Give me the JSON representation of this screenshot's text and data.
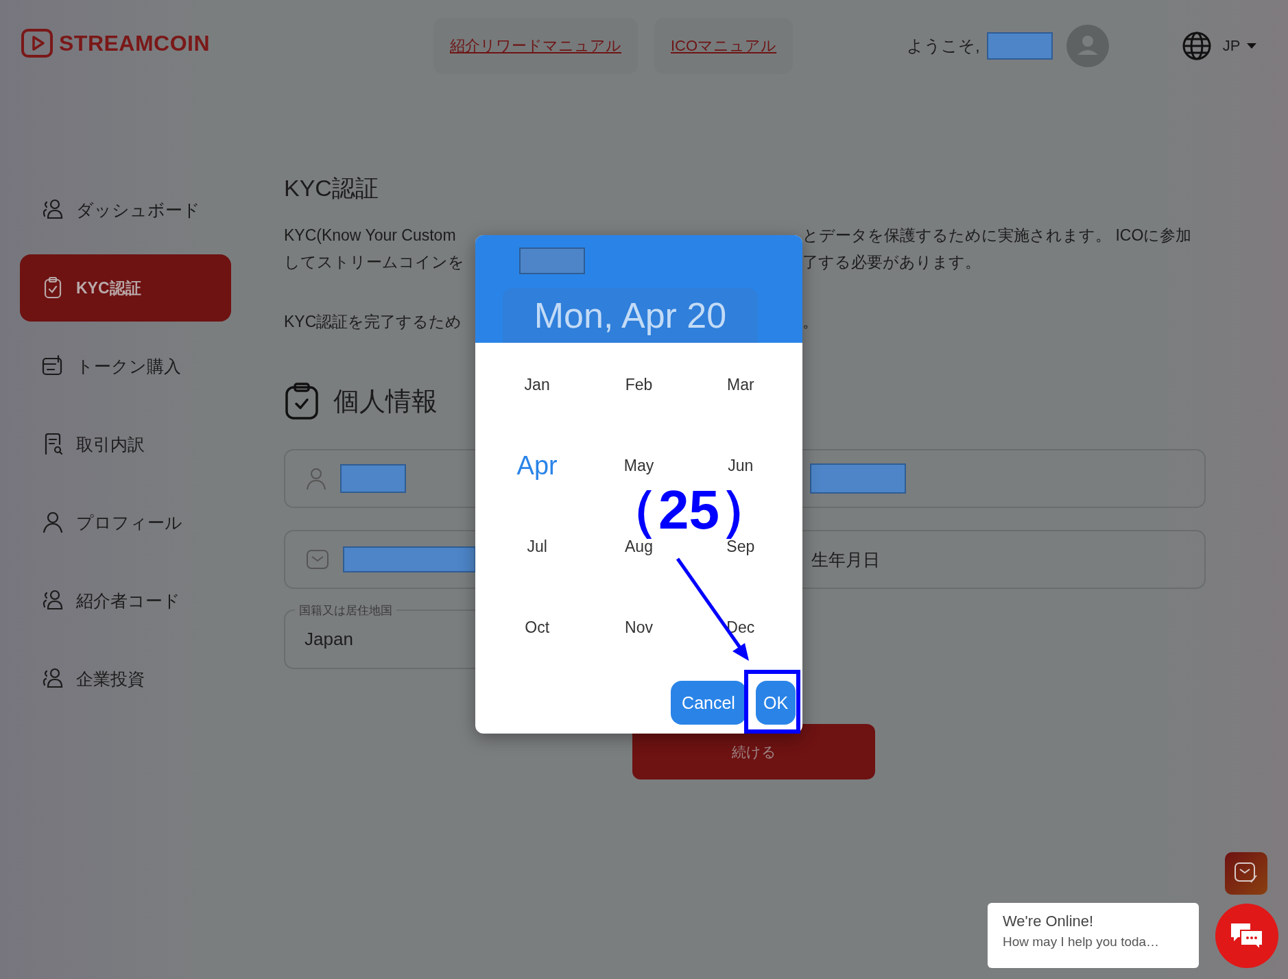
{
  "logo": {
    "text": "STREAMCOIN"
  },
  "header": {
    "links": [
      "紹介リワードマニュアル",
      "ICOマニュアル"
    ],
    "welcome": "ようこそ,",
    "language": "JP"
  },
  "sidebar": {
    "items": [
      {
        "label": "ダッシュボード",
        "kind": "users",
        "selected": false
      },
      {
        "label": "KYC認証",
        "kind": "clipboard",
        "selected": true
      },
      {
        "label": "トークン購入",
        "kind": "wallet",
        "selected": false
      },
      {
        "label": "取引内訳",
        "kind": "receipt",
        "selected": false
      },
      {
        "label": "プロフィール",
        "kind": "user",
        "selected": false
      },
      {
        "label": "紹介者コード",
        "kind": "users",
        "selected": false
      },
      {
        "label": "企業投資",
        "kind": "users",
        "selected": false
      }
    ]
  },
  "main": {
    "title": "KYC認証",
    "intro_lines": [
      {
        "left": "KYC(Know Your Custom",
        "right": "とデータを保護するために実施されます。 ICOに参加"
      },
      {
        "left": "してストリームコインを",
        "right": "了する必要があります。"
      }
    ],
    "note": {
      "left": "KYC認証を完了するため",
      "right": "。"
    },
    "section_title": "個人情報",
    "form": {
      "birthdate_placeholder": "生年月日",
      "country": {
        "label": "国籍又は居住地国",
        "value": "Japan"
      }
    },
    "continue_button": "続ける"
  },
  "date_picker": {
    "date": "Mon, Apr 20",
    "months": [
      {
        "label": "Jan",
        "selected": false
      },
      {
        "label": "Feb",
        "selected": false
      },
      {
        "label": "Mar",
        "selected": false
      },
      {
        "label": "Apr",
        "selected": true
      },
      {
        "label": "May",
        "selected": false
      },
      {
        "label": "Jun",
        "selected": false
      },
      {
        "label": "Jul",
        "selected": false
      },
      {
        "label": "Aug",
        "selected": false
      },
      {
        "label": "Sep",
        "selected": false
      },
      {
        "label": "Oct",
        "selected": false
      },
      {
        "label": "Nov",
        "selected": false
      },
      {
        "label": "Dec",
        "selected": false
      }
    ],
    "buttons": [
      "Cancel",
      "OK"
    ]
  },
  "annotation": {
    "label": "（25）"
  },
  "chat": {
    "title": "We're Online!",
    "message": "How may I help you toda…"
  }
}
